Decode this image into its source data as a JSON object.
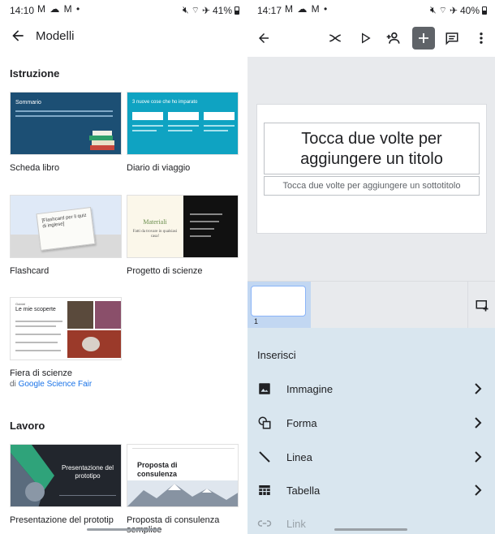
{
  "left": {
    "status": {
      "time": "14:10",
      "notif_icons": "M ☁ M •",
      "battery": "41%"
    },
    "header": {
      "title": "Modelli"
    },
    "sections": [
      {
        "title": "Istruzione",
        "templates": [
          {
            "label": "Scheda libro",
            "thumb_title": "Sommario"
          },
          {
            "label": "Diario di viaggio",
            "thumb_title": "3 nuove cose che ho imparato"
          },
          {
            "label": "Flashcard",
            "thumb_title": "[Flashcard per il quiz di inglese]"
          },
          {
            "label": "Progetto di scienze",
            "thumb_title": "Materiali",
            "thumb_sub": "Fatti da trovare in qualsiasi casa!"
          },
          {
            "label": "Fiera di scienze",
            "sub_prefix": "di",
            "sub_link": "Google Science Fair",
            "thumb_title": "Le mie scoperte",
            "thumb_kicker": "Guidat"
          }
        ]
      },
      {
        "title": "Lavoro",
        "templates": [
          {
            "label": "Presentazione del prototip",
            "thumb_title": "Presentazione del prototipo"
          },
          {
            "label": "Proposta di consulenza",
            "label2": "semplice",
            "thumb_title": "Proposta di consulenza"
          }
        ]
      }
    ]
  },
  "right": {
    "status": {
      "time": "14:17",
      "notif_icons": "M ☁ M •",
      "battery": "40%"
    },
    "slide": {
      "title_placeholder": "Tocca due volte per aggiungere un titolo",
      "subtitle_placeholder": "Tocca due volte per aggiungere un sottotitolo"
    },
    "filmstrip": {
      "slide_number": "1"
    },
    "insert": {
      "title": "Inserisci",
      "items": [
        {
          "label": "Immagine",
          "icon": "image-icon"
        },
        {
          "label": "Forma",
          "icon": "shape-icon"
        },
        {
          "label": "Linea",
          "icon": "line-icon"
        },
        {
          "label": "Tabella",
          "icon": "table-icon"
        },
        {
          "label": "Link",
          "icon": "link-icon"
        }
      ]
    }
  },
  "colors": {
    "accent": "#1a73e8",
    "insert_panel": "#d9e6ef",
    "canvas": "#e8eaed"
  }
}
